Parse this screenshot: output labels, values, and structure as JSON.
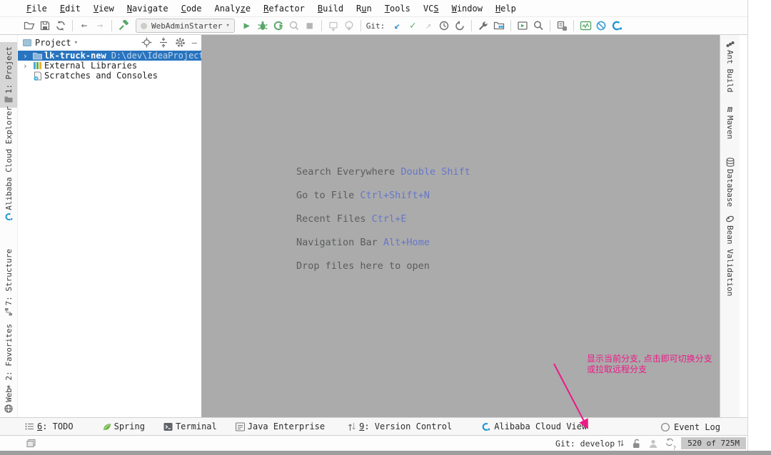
{
  "colors": {
    "selection_blue": "#2874BF",
    "run_green": "#59A869",
    "vcs_blue": "#3895C9",
    "shortcut_blue": "#6577C9",
    "editor_bg": "#ABABAB",
    "annotation_pink": "#EC1A87",
    "alibaba_blue": "#2196D3"
  },
  "menubar": {
    "items": [
      {
        "label": "File",
        "mnemonic": 0
      },
      {
        "label": "Edit",
        "mnemonic": 0
      },
      {
        "label": "View",
        "mnemonic": 0
      },
      {
        "label": "Navigate",
        "mnemonic": 0
      },
      {
        "label": "Code",
        "mnemonic": 0
      },
      {
        "label": "Analyze",
        "mnemonic": 5
      },
      {
        "label": "Refactor",
        "mnemonic": 0
      },
      {
        "label": "Build",
        "mnemonic": 0
      },
      {
        "label": "Run",
        "mnemonic": 1
      },
      {
        "label": "Tools",
        "mnemonic": 0
      },
      {
        "label": "VCS",
        "mnemonic": 2
      },
      {
        "label": "Window",
        "mnemonic": 0
      },
      {
        "label": "Help",
        "mnemonic": 0
      }
    ]
  },
  "toolbar": {
    "run_config": "WebAdminStarter",
    "git_label": "Git:",
    "icons": [
      "open-icon",
      "save-icon",
      "sync-icon",
      "back-icon",
      "forward-icon",
      "build-hammer-icon",
      "run-icon",
      "debug-icon",
      "coverage-icon",
      "profiler-icon",
      "stop-icon",
      "attach-icon",
      "update-running-icon",
      "vcs-update-icon",
      "commit-icon",
      "push-icon",
      "history-icon",
      "rollback-icon",
      "wrench-icon",
      "modules-icon",
      "run-anything-icon",
      "search-icon",
      "services-save-icon",
      "activity-monitor-icon",
      "block-icon",
      "alibaba-cloud-icon"
    ]
  },
  "left_stripe": {
    "items": [
      {
        "label": "1: Project",
        "icon": "project-folder-icon",
        "active": true
      },
      {
        "label": "Alibaba Cloud Explorer",
        "icon": "alibaba-cloud-icon",
        "active": false
      },
      {
        "label": "7: Structure",
        "icon": "structure-icon",
        "active": false
      },
      {
        "label": "2: Favorites",
        "icon": "star-icon",
        "active": false
      },
      {
        "label": "Web",
        "icon": "web-globe-icon",
        "active": false
      }
    ]
  },
  "right_stripe": {
    "items": [
      {
        "label": "Ant Build",
        "icon": "ant-icon"
      },
      {
        "label": "Maven",
        "icon": "maven-icon"
      },
      {
        "label": "Database",
        "icon": "database-icon"
      },
      {
        "label": "Bean Validation",
        "icon": "bean-icon"
      }
    ]
  },
  "project_panel": {
    "title": "Project",
    "header_icons": [
      "locate-icon",
      "collapse-all-icon",
      "gear-icon",
      "hide-icon"
    ],
    "tree": [
      {
        "name": "lk-truck-new",
        "path": "D:\\dev\\IdeaProjects\\l",
        "selected": true
      },
      {
        "name": "External Libraries",
        "path": "",
        "selected": false
      },
      {
        "name": "Scratches and Consoles",
        "path": "",
        "selected": false
      }
    ]
  },
  "editor": {
    "shortcuts": [
      {
        "label": "Search Everywhere ",
        "keys": "Double Shift"
      },
      {
        "label": "Go to File ",
        "keys": "Ctrl+Shift+N"
      },
      {
        "label": "Recent Files ",
        "keys": "Ctrl+E"
      },
      {
        "label": "Navigation Bar ",
        "keys": "Alt+Home"
      },
      {
        "label": "Drop files here to open",
        "keys": ""
      }
    ]
  },
  "annotation": {
    "line1": "显示当前分支, 点击即可切换分支",
    "line2": "或拉取远程分支"
  },
  "bottom_bar": {
    "items": [
      {
        "label": "6: TODO",
        "mnemonic": 0,
        "icon": "todo-icon"
      },
      {
        "label": "Spring",
        "mnemonic": -1,
        "icon": "spring-leaf-icon"
      },
      {
        "label": "Terminal",
        "mnemonic": -1,
        "icon": "terminal-icon"
      },
      {
        "label": "Java Enterprise",
        "mnemonic": -1,
        "icon": "java-enterprise-icon"
      },
      {
        "label": "9: Version Control",
        "mnemonic": 0,
        "icon": "version-control-icon"
      },
      {
        "label": "Alibaba Cloud View",
        "mnemonic": -1,
        "icon": "alibaba-cloud-icon"
      }
    ],
    "event_log": "Event Log"
  },
  "status_bar": {
    "git": "Git: develop",
    "memory": "520 of 725M"
  }
}
